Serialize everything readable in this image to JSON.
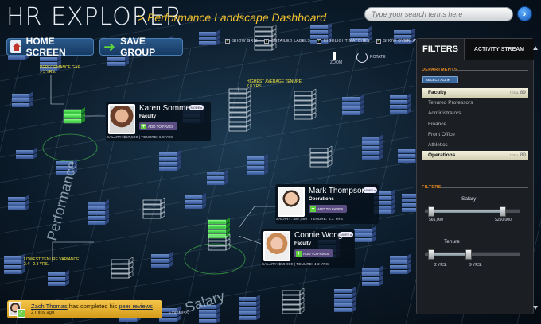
{
  "header": {
    "app_title": "HR EXPLORER",
    "subtitle": "> Performance Landscape Dashboard",
    "search_placeholder": "Type your search terms here",
    "search_go": "›"
  },
  "toolbar": {
    "home_label": "HOME SCREEN",
    "save_label": "SAVE GROUP",
    "toggles": [
      {
        "label": "SHOW GRID",
        "checked": true
      },
      {
        "label": "DETAILED LABELS",
        "checked": true
      },
      {
        "label": "HIGHLIGHT MATCHES",
        "checked": true
      },
      {
        "label": "SHOW OVERLAYS",
        "checked": true
      }
    ],
    "zoom_label": "ZOOM",
    "zoom_level": 0.8,
    "rotate_label": "ROTATE"
  },
  "landscape": {
    "tags": [
      {
        "line1": "PERFORMANCE GAP",
        "line2": "> 3 YRS."
      },
      {
        "line1": "HIGHEST AVERAGE TENURE",
        "line2": "7.8 YRS."
      },
      {
        "line1": "LOWEST TENURE VARIANCE",
        "line2": "2.4 - 2.8 YRS."
      }
    ],
    "axis_performance": "Performance",
    "axis_salary": "Salary"
  },
  "people": [
    {
      "name": "Karen Sommer",
      "dept": "Faculty",
      "fave": "ADD TO FAVES",
      "more": "MORE ▸",
      "stats": "SALARY: $57,500  |  TENURE: 6.8 YRS"
    },
    {
      "name": "Mark Thompson",
      "dept": "Operations",
      "fave": "ADD TO FAVES",
      "more": "MORE ▸",
      "stats": "SALARY: $87,500  |  TENURE: 5.2 YRS"
    },
    {
      "name": "Connie Wong",
      "dept": "Faculty",
      "fave": "ADD TO FAVES",
      "more": "MORE ▸",
      "stats": "SALARY: $59,000  |  TENURE: 4.2 YRS"
    }
  ],
  "panel": {
    "tab_filters": "FILTERS",
    "tab_activity": "ACTIVITY STREAM",
    "departments_head": "DEPARTMENTS",
    "select_all": "SELECT ALL ▸",
    "departments": [
      {
        "label": "Faculty",
        "selected": true,
        "total_label": "TOTAL",
        "total": "89"
      },
      {
        "label": "Tenured Professors",
        "selected": false
      },
      {
        "label": "Administrators",
        "selected": false
      },
      {
        "label": "Finance",
        "selected": false
      },
      {
        "label": "Front Office",
        "selected": false
      },
      {
        "label": "Athletics",
        "selected": false
      },
      {
        "label": "Operations",
        "selected": true,
        "total_label": "TOTAL",
        "total": "89"
      }
    ],
    "filters_head": "FILTERS",
    "salary_title": "Salary",
    "salary_min": "$65,000",
    "salary_max": "$250,000",
    "salary_range": [
      0.07,
      0.82
    ],
    "tenure_title": "Tenure",
    "tenure_min": "2 YRS.",
    "tenure_max": "9 YRS.",
    "tenure_range": [
      0.07,
      0.46
    ]
  },
  "notification": {
    "user": "Zach Thomas",
    "text": " has completed his ",
    "link": "peer reviews",
    "time": "2 mins ago",
    "dismiss": "× DISMISS"
  },
  "colors": {
    "accent_yellow": "#f2c230",
    "highlight_green": "#39e04a",
    "panel_orange": "#e58a26",
    "block_blue": "#4d6fb8"
  }
}
